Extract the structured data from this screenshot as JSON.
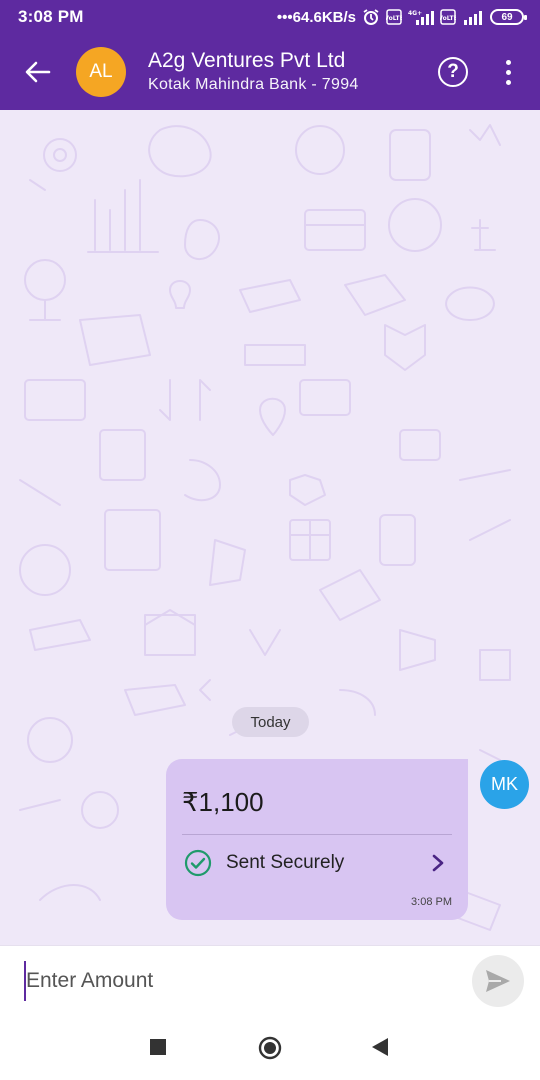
{
  "status_bar": {
    "time": "3:08 PM",
    "network_speed": "•••64.6KB/s",
    "battery": "69"
  },
  "header": {
    "avatar_initials": "AL",
    "title": "A2g Ventures Pvt Ltd",
    "subtitle": "Kotak Mahindra Bank  - 7994",
    "help_label": "?"
  },
  "chat": {
    "day_label": "Today",
    "message": {
      "amount": "₹1,100",
      "status": "Sent Securely",
      "time": "3:08 PM"
    },
    "sender_initials": "MK"
  },
  "input": {
    "placeholder": "Enter Amount"
  },
  "colors": {
    "header_bg": "#5e2aa0",
    "bubble_bg": "#d8c5f2",
    "avatar_al": "#f5a623",
    "avatar_mk": "#2aa3e8",
    "success": "#1f9a6b"
  },
  "icons": {
    "back": "back-arrow-icon",
    "help": "help-icon",
    "more": "more-vertical-icon",
    "status": "check-circle-icon",
    "detail": "chevron-right-icon",
    "send": "send-icon",
    "nav_recents": "square-icon",
    "nav_home": "circle-icon",
    "nav_back": "triangle-back-icon"
  }
}
